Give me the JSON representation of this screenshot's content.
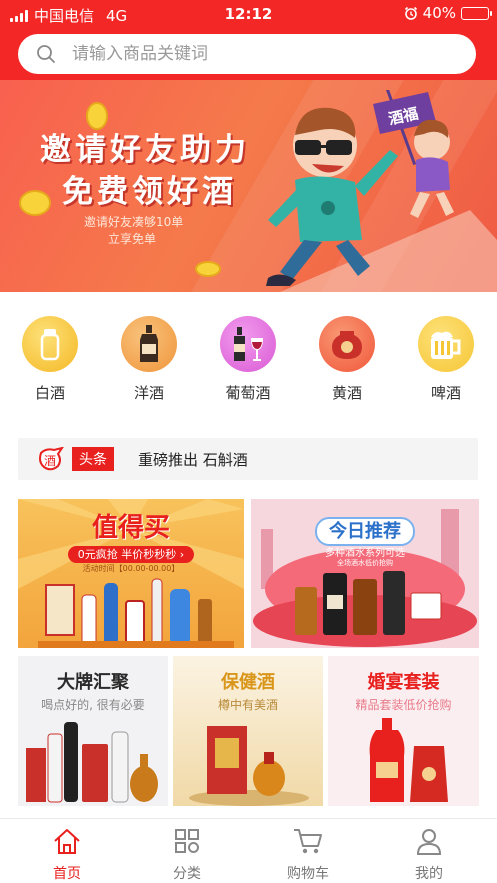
{
  "status_bar": {
    "carrier": "中国电信",
    "network": "4G",
    "time": "12:12",
    "battery": "40%",
    "battery_level": 0.4
  },
  "search": {
    "placeholder": "请输入商品关键词",
    "icon": "search-icon"
  },
  "banner": {
    "headline_1": "邀请好友助力",
    "headline_2": "免费领好酒",
    "subtext_1": "邀请好友凑够10单",
    "subtext_2": "立享免单",
    "flag_text": "酒福",
    "slide_count": 3,
    "active_slide": 2
  },
  "categories": [
    {
      "label": "白酒",
      "icon": "baijiu-icon",
      "color": "#f4b824"
    },
    {
      "label": "洋酒",
      "icon": "whisky-icon",
      "color": "#f0953a"
    },
    {
      "label": "葡萄酒",
      "icon": "wine-icon",
      "color": "#d95ad4"
    },
    {
      "label": "黄酒",
      "icon": "huangjiu-icon",
      "color": "#f0573a"
    },
    {
      "label": "啤酒",
      "icon": "beer-icon",
      "color": "#f6c635"
    }
  ],
  "news": {
    "logo_text": "酒",
    "tag": "头条",
    "headline": "重磅推出 石斛酒"
  },
  "promos": {
    "p1": {
      "title": "值得买",
      "subtitle": "0元疯抢  半价秒秒秒 ›",
      "note": "活动时间【00.00-00.00】"
    },
    "p2": {
      "title": "今日推荐",
      "subtitle": "多种酒水系列可选",
      "note": "全场酒水低价抢购"
    },
    "p3": {
      "title": "大牌汇聚",
      "subtitle": "喝点好的, 很有必要"
    },
    "p4": {
      "title": "保健酒",
      "subtitle": "樽中有美酒"
    },
    "p5": {
      "title": "婚宴套装",
      "subtitle": "精品套装低价抢购"
    }
  },
  "tabbar": [
    {
      "label": "首页",
      "icon": "home-icon",
      "active": true
    },
    {
      "label": "分类",
      "icon": "grid-icon",
      "active": false
    },
    {
      "label": "购物车",
      "icon": "cart-icon",
      "active": false
    },
    {
      "label": "我的",
      "icon": "user-icon",
      "active": false
    }
  ],
  "colors": {
    "brand_red": "#f42727",
    "tag_red": "#e8201e",
    "text": "#333333",
    "muted": "#777777"
  }
}
